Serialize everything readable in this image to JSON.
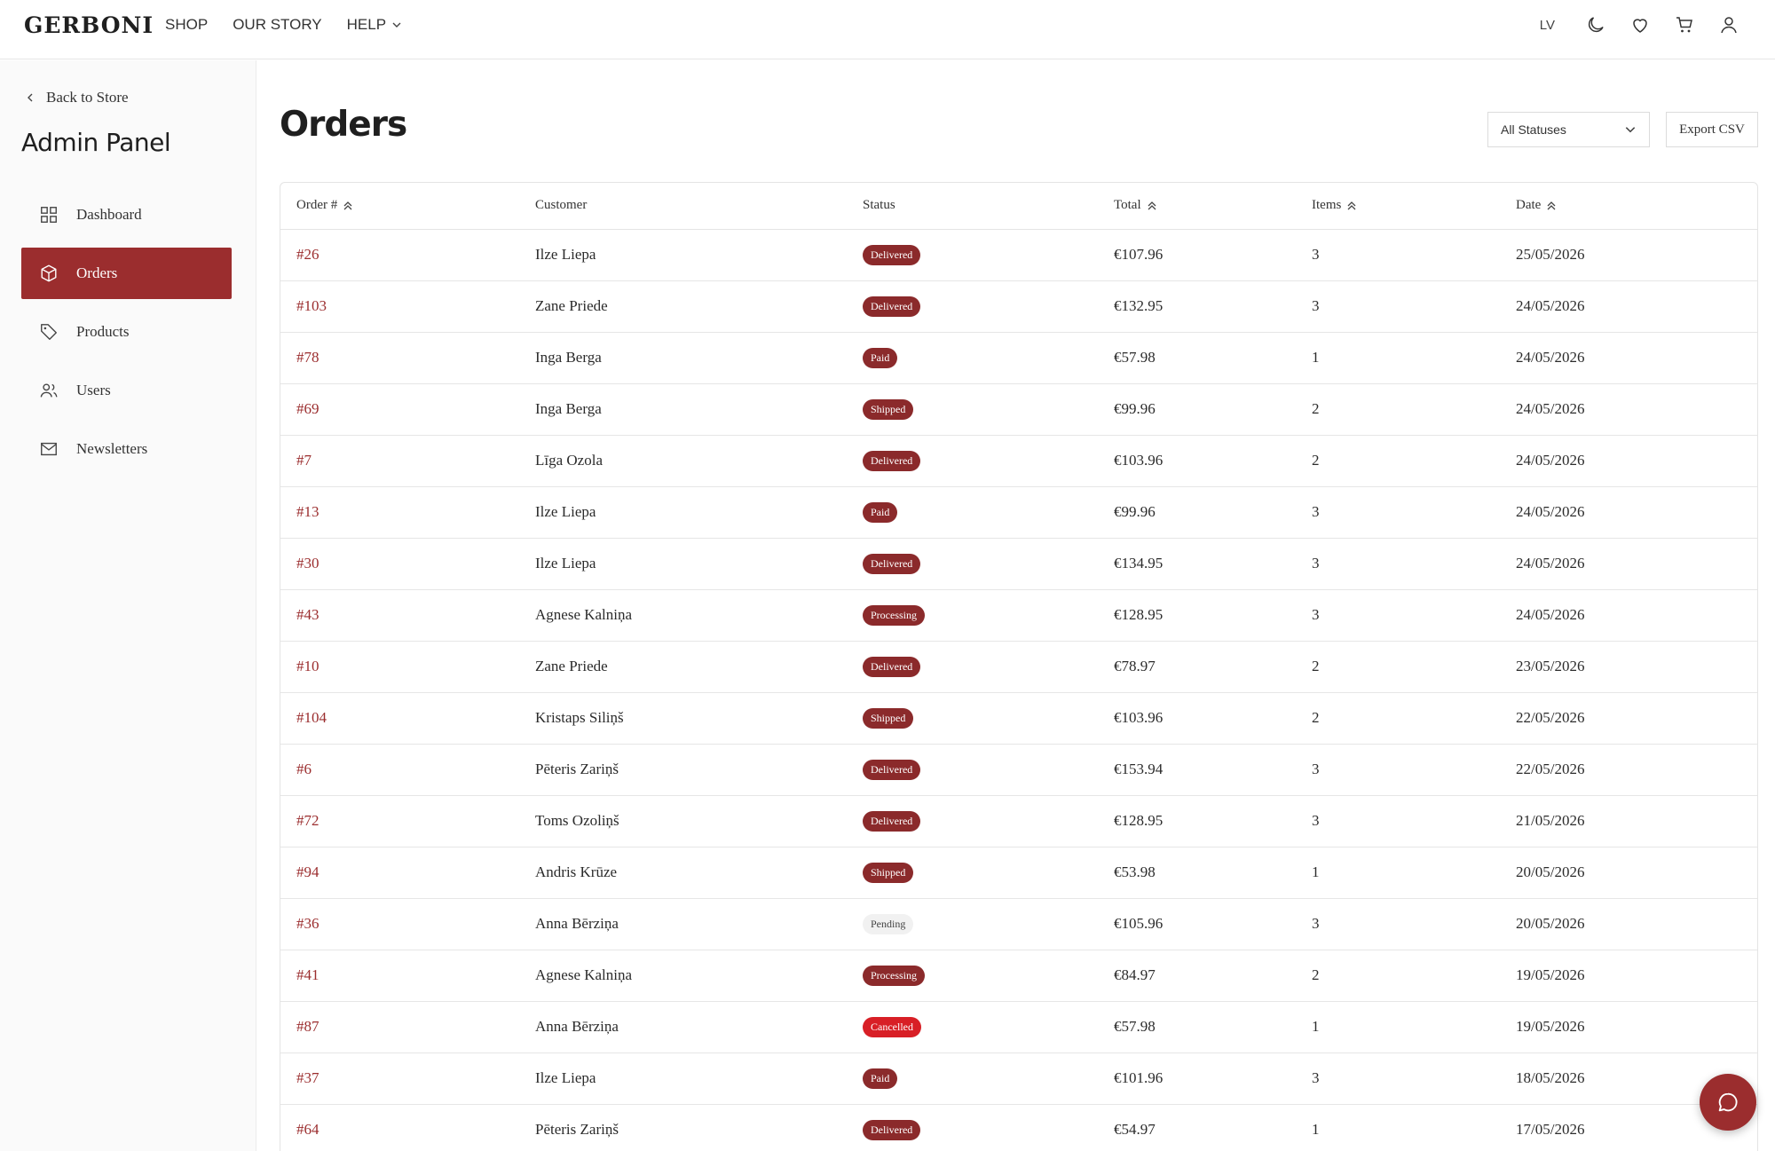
{
  "brand": {
    "logo": "GERBONI",
    "accent": "#9b2d2e"
  },
  "nav": {
    "shop": "SHOP",
    "story": "OUR STORY",
    "help": "HELP",
    "lang": "LV"
  },
  "sidebar": {
    "back": "Back to Store",
    "title": "Admin Panel",
    "items": [
      {
        "label": "Dashboard",
        "icon": "grid-icon"
      },
      {
        "label": "Orders",
        "icon": "box-icon",
        "active": true
      },
      {
        "label": "Products",
        "icon": "tag-icon"
      },
      {
        "label": "Users",
        "icon": "users-icon"
      },
      {
        "label": "Newsletters",
        "icon": "mail-icon"
      }
    ]
  },
  "main": {
    "title": "Orders",
    "filter": "All Statuses",
    "export": "Export CSV"
  },
  "table": {
    "headers": [
      "Order #",
      "Customer",
      "Status",
      "Total",
      "Items",
      "Date"
    ],
    "rows": [
      {
        "order": "#26",
        "customer": "Ilze Liepa",
        "status": "Delivered",
        "total": "€107.96",
        "items": "3",
        "date": "25/05/2026"
      },
      {
        "order": "#103",
        "customer": "Zane Priede",
        "status": "Delivered",
        "total": "€132.95",
        "items": "3",
        "date": "24/05/2026"
      },
      {
        "order": "#78",
        "customer": "Inga Berga",
        "status": "Paid",
        "total": "€57.98",
        "items": "1",
        "date": "24/05/2026"
      },
      {
        "order": "#69",
        "customer": "Inga Berga",
        "status": "Shipped",
        "total": "€99.96",
        "items": "2",
        "date": "24/05/2026"
      },
      {
        "order": "#7",
        "customer": "Līga Ozola",
        "status": "Delivered",
        "total": "€103.96",
        "items": "2",
        "date": "24/05/2026"
      },
      {
        "order": "#13",
        "customer": "Ilze Liepa",
        "status": "Paid",
        "total": "€99.96",
        "items": "3",
        "date": "24/05/2026"
      },
      {
        "order": "#30",
        "customer": "Ilze Liepa",
        "status": "Delivered",
        "total": "€134.95",
        "items": "3",
        "date": "24/05/2026"
      },
      {
        "order": "#43",
        "customer": "Agnese Kalniņa",
        "status": "Processing",
        "total": "€128.95",
        "items": "3",
        "date": "24/05/2026"
      },
      {
        "order": "#10",
        "customer": "Zane Priede",
        "status": "Delivered",
        "total": "€78.97",
        "items": "2",
        "date": "23/05/2026"
      },
      {
        "order": "#104",
        "customer": "Kristaps Siliņš",
        "status": "Shipped",
        "total": "€103.96",
        "items": "2",
        "date": "22/05/2026"
      },
      {
        "order": "#6",
        "customer": "Pēteris Zariņš",
        "status": "Delivered",
        "total": "€153.94",
        "items": "3",
        "date": "22/05/2026"
      },
      {
        "order": "#72",
        "customer": "Toms Ozoliņš",
        "status": "Delivered",
        "total": "€128.95",
        "items": "3",
        "date": "21/05/2026"
      },
      {
        "order": "#94",
        "customer": "Andris Krūze",
        "status": "Shipped",
        "total": "€53.98",
        "items": "1",
        "date": "20/05/2026"
      },
      {
        "order": "#36",
        "customer": "Anna Bērziņa",
        "status": "Pending",
        "total": "€105.96",
        "items": "3",
        "date": "20/05/2026"
      },
      {
        "order": "#41",
        "customer": "Agnese Kalniņa",
        "status": "Processing",
        "total": "€84.97",
        "items": "2",
        "date": "19/05/2026"
      },
      {
        "order": "#87",
        "customer": "Anna Bērziņa",
        "status": "Cancelled",
        "total": "€57.98",
        "items": "1",
        "date": "19/05/2026"
      },
      {
        "order": "#37",
        "customer": "Ilze Liepa",
        "status": "Paid",
        "total": "€101.96",
        "items": "3",
        "date": "18/05/2026"
      },
      {
        "order": "#64",
        "customer": "Pēteris Zariņš",
        "status": "Delivered",
        "total": "€54.97",
        "items": "1",
        "date": "17/05/2026"
      }
    ]
  }
}
